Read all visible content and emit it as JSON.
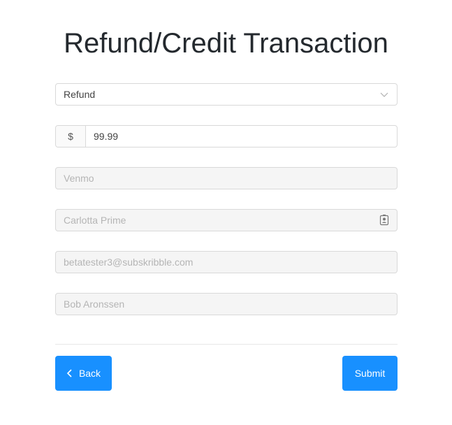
{
  "form": {
    "title": "Refund/Credit Transaction",
    "transaction_type": {
      "selected": "Refund",
      "icon": "chevron-down-icon"
    },
    "amount": {
      "currency_symbol": "$",
      "value": "99.99"
    },
    "payment_method": {
      "placeholder": "Venmo"
    },
    "customer_name": {
      "placeholder": "Carlotta Prime",
      "icon": "contact-card-icon"
    },
    "customer_email": {
      "placeholder": "betatester3@subskribble.com"
    },
    "representative": {
      "placeholder": "Bob Aronssen"
    }
  },
  "actions": {
    "back_label": "Back",
    "back_icon": "chevron-left-icon",
    "submit_label": "Submit"
  },
  "colors": {
    "primary": "#1890ff",
    "border": "#d9d9d9",
    "disabled_bg": "#f5f5f5",
    "disabled_text": "#b5b5b5",
    "title": "#24292e"
  }
}
